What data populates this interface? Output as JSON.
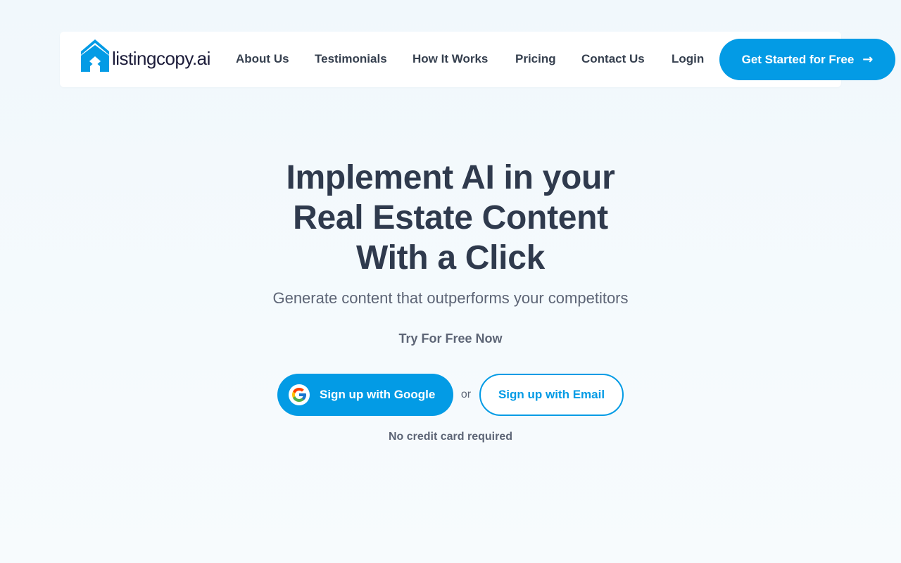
{
  "brand": {
    "name": "listingcopy.ai",
    "icon": "house-logo-icon",
    "accent_color": "#039be5"
  },
  "nav": {
    "items": [
      {
        "label": "About Us"
      },
      {
        "label": "Testimonials"
      },
      {
        "label": "How It Works"
      },
      {
        "label": "Pricing"
      },
      {
        "label": "Contact Us"
      },
      {
        "label": "Login"
      }
    ],
    "cta_label": "Get Started for Free",
    "cta_icon": "arrow-right-icon"
  },
  "hero": {
    "title_lines": [
      "Implement AI in your",
      "Real Estate Content",
      "With a Click"
    ],
    "subtitle": "Generate content that outperforms your competitors",
    "try_label": "Try For Free Now",
    "google_button_label": "Sign up with Google",
    "google_icon": "google-g-icon",
    "or_label": "or",
    "email_button_label": "Sign up with Email",
    "note": "No credit card required"
  }
}
